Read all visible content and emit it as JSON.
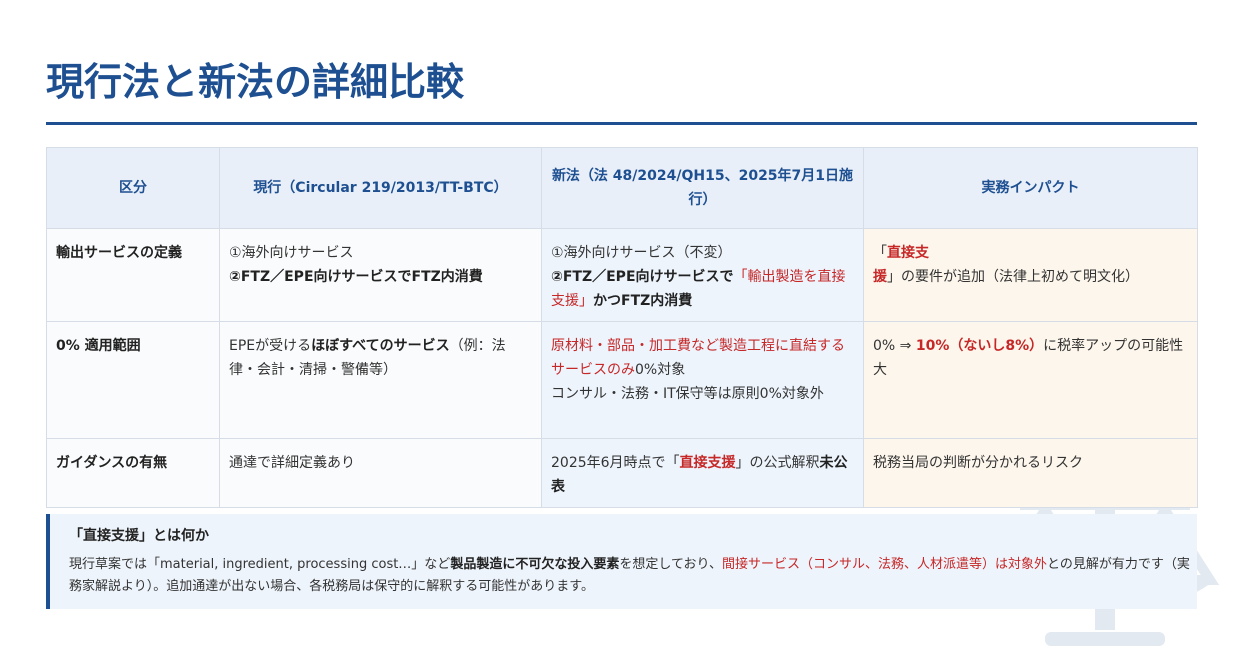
{
  "title": "現行法と新法の詳細比較",
  "table": {
    "headers": [
      "区分",
      "現行（Circular 219/2013/TT-BTC）",
      "新法（法 48/2024/QH15、2025年7月1日施行）",
      "実務インパクト"
    ],
    "rows": [
      {
        "category": "輸出サービスの定義",
        "current": [
          [
            {
              "t": "①海外向けサービス",
              "s": ""
            }
          ],
          [
            {
              "t": "②FTZ／EPE向けサービスでFTZ内消費",
              "s": "b"
            }
          ]
        ],
        "new": [
          [
            {
              "t": "①海外向けサービス（不変）",
              "s": ""
            }
          ],
          [
            {
              "t": "②FTZ／EPE向けサービスで",
              "s": "b"
            },
            {
              "t": "「輸出製造を直接支援」",
              "s": "red"
            },
            {
              "t": "かつFTZ内消費",
              "s": "b"
            }
          ]
        ],
        "impact": [
          [
            {
              "t": "「",
              "s": ""
            },
            {
              "t": "直接支援",
              "s": "red b"
            },
            {
              "t": "」の要件が追加（法律上初めて明文化）",
              "s": ""
            }
          ]
        ]
      },
      {
        "category": "0% 適用範囲",
        "current": [
          [
            {
              "t": "EPEが受ける",
              "s": ""
            },
            {
              "t": "ほぼすべてのサービス",
              "s": "b"
            },
            {
              "t": "（例：法律・会計・清掃・警備等）",
              "s": ""
            }
          ]
        ],
        "new": [
          [
            {
              "t": "原材料・部品・加工費など製造工程に直結するサービスのみ",
              "s": "red"
            },
            {
              "t": "0%対象",
              "s": ""
            }
          ],
          [
            {
              "t": "コンサル・法務・IT保守等は原則0%対象外",
              "s": ""
            }
          ]
        ],
        "impact": [
          [
            {
              "t": "0% ⇒ ",
              "s": ""
            },
            {
              "t": "10%（ないし8%）",
              "s": "red b"
            },
            {
              "t": "に税率アップの可能性大",
              "s": ""
            }
          ]
        ]
      },
      {
        "category": "ガイダンスの有無",
        "current": [
          [
            {
              "t": "通達で詳細定義あり",
              "s": ""
            }
          ]
        ],
        "new": [
          [
            {
              "t": "2025年6月時点で「",
              "s": ""
            },
            {
              "t": "直接支援",
              "s": "red b"
            },
            {
              "t": "」の公式解釈",
              "s": ""
            },
            {
              "t": "未公表",
              "s": "b"
            }
          ]
        ],
        "impact": [
          [
            {
              "t": "税務当局の判断が分かれるリスク",
              "s": ""
            }
          ]
        ]
      }
    ]
  },
  "note": {
    "title": "「直接支援」とは何か",
    "segments": [
      {
        "t": "現行草案では「material, ingredient, processing cost…」など",
        "s": ""
      },
      {
        "t": "製品製造に不可欠な投入要素",
        "s": "b"
      },
      {
        "t": "を想定しており、",
        "s": ""
      },
      {
        "t": "間接サービス（コンサル、法務、人材派遣等）は対象外",
        "s": "red"
      },
      {
        "t": "との見解が有力です（実務家解説より）。追加通達が出ない場合、各税務局は保守的に解釈する可能性があります。",
        "s": ""
      }
    ]
  },
  "colors": {
    "accent": "#1d4f91",
    "highlight_red": "#c62828",
    "header_bg": "#e8eff8",
    "new_col_bg": "#edf4fc",
    "impact_col_bg": "#fdf6ec",
    "note_bg": "#eef4fb"
  },
  "icons": {
    "watermark": "balance-scale-icon"
  }
}
